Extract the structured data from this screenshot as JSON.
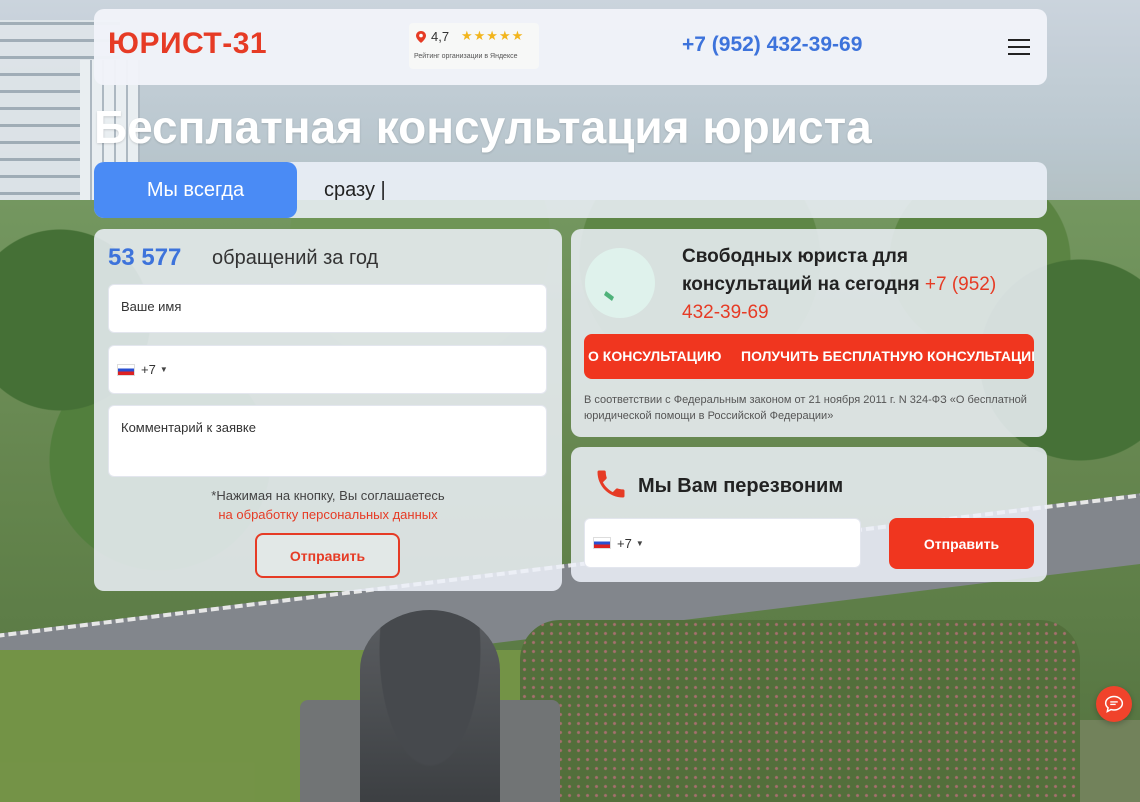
{
  "header": {
    "logo": "ЮРИСТ-31",
    "rating": {
      "score": "4,7",
      "stars": "★★★★★",
      "caption": "Рейтинг организации в Яндексе"
    },
    "phone": "+7 (952) 432-39-69"
  },
  "hero": {
    "title": "Бесплатная консультация юриста",
    "lead": "Мы всегда",
    "typed": "сразу |"
  },
  "form": {
    "count": "53 577",
    "count_label": "обращений за год",
    "name_placeholder": "Ваше имя",
    "phone_code": "+7",
    "comment_placeholder": "Комментарий к заявке",
    "agree_text": "*Нажимая на кнопку, Вы соглашаетесь",
    "agree_link": "на обработку персональных данных",
    "submit_label": "Отправить"
  },
  "free": {
    "text": "Свободных юриста для консультаций на сегодня",
    "phone": "+7 (952) 432-39-69",
    "marquee_left": "О КОНСУЛЬТАЦИЮ",
    "marquee_right": "ПОЛУЧИТЬ БЕСПЛАТНУЮ КОНСУЛЬТАЦИЮ",
    "law": "В соответствии с Федеральным законом от 21 ноября 2011 г. N 324-ФЗ «О бесплатной юридической помощи в Российской Федерации»"
  },
  "callback": {
    "title": "Мы Вам перезвоним",
    "phone_code": "+7",
    "submit_label": "Отправить"
  },
  "colors": {
    "brand_red": "#e63b25",
    "accent_blue": "#3d73db"
  },
  "icons": {
    "location": "location-pin-icon",
    "menu": "hamburger-menu-icon",
    "phone": "phone-icon",
    "chat": "chat-icon"
  }
}
